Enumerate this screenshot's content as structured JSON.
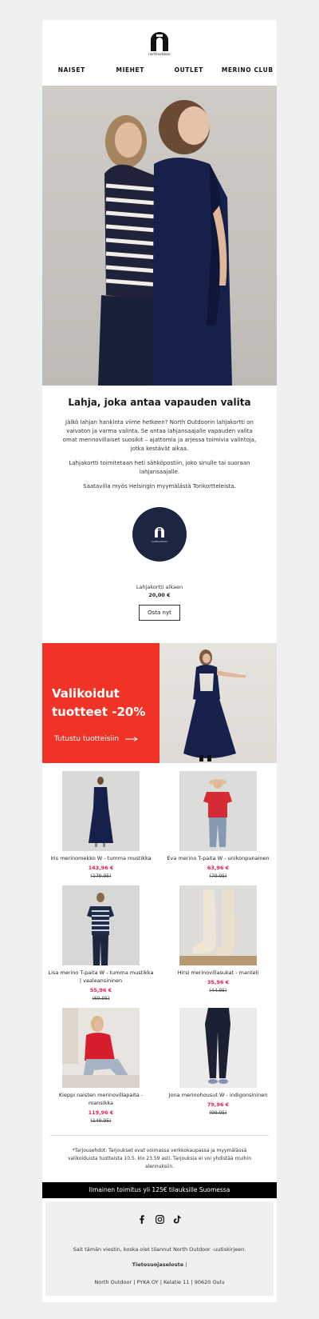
{
  "brand": {
    "name": "northoutdoor"
  },
  "nav": [
    "NAISET",
    "MIEHET",
    "OUTLET",
    "MERINO CLUB"
  ],
  "intro": {
    "title": "Lahja, joka antaa vapauden valita",
    "p1": "Jäikö lahjan hankinta viime hetkeen? North Outdoorin lahjakortti on vaivaton ja varma valinta. Se antaa lahjansaajalle vapauden valita omat merinovillaiset suosikit – ajattomia ja arjessa toimivia valintoja, jotka kestävät aikaa.",
    "p2": "Lahjakortti toimitetaan heti sähköpostiin, joko sinulle tai suoraan lahjansaajalle.",
    "p3": "Saatavilla myös Helsingin myymälästä Torikortteleista."
  },
  "gift": {
    "card_text": "northoutdoor",
    "label": "Lahjakortti alkaen",
    "price": "20,00 €",
    "button": "Osta nyt"
  },
  "promo": {
    "title_line1": "Valikoidut",
    "title_line2": "tuotteet -20%",
    "cta": "Tutustu tuotteisiin",
    "bg_color": "#ef3427"
  },
  "products": [
    {
      "name": "Iris merinomekko W - tumma mustikka",
      "price": "143,96 €",
      "old": "(179.95)"
    },
    {
      "name": "Eva merino T-paita W - unikonpunainen",
      "price": "63,96 €",
      "old": "(79.95)"
    },
    {
      "name": "Lisa merino T-paita W - tumma mustikka | vaaleansininen",
      "price": "55,96 €",
      "old": "(69.95)"
    },
    {
      "name": "Hirsi merinovillasukat - manteli",
      "price": "35,96 €",
      "old": "(44.95)"
    },
    {
      "name": "Kieppi naisten merinovillapaita - mansikka",
      "price": "119,96 €",
      "old": "(149.95)"
    },
    {
      "name": "Jona merinohousut W - indigonsininen",
      "price": "79,96 €",
      "old": "(99.95)"
    }
  ],
  "terms": "*Tarjousehdot: Tarjoukset ovat voimassa verkkokaupassa ja myymälässä valikoiduista tuotteista 10.5. klo 23.59 asti. Tarjouksia ei voi yhdistää muihin alennuksiin.",
  "shipping": "Ilmainen toimitus yli 125€ tilauksille Suomessa",
  "footer": {
    "socials": [
      "facebook-icon",
      "instagram-icon",
      "tiktok-icon"
    ],
    "reason": "Sait tämän viestin, koska olet tilannut North Outdoor -uutiskirjeen.",
    "privacy": "Tietosuojaseloste",
    "separator": "|",
    "address": "North Outdoor | PYKA OY | Kelatie 11 | 90620 Oulu"
  },
  "colors": {
    "price_red": "#e8204a",
    "gift_navy": "#1e2540",
    "shipbar": "#000000"
  }
}
